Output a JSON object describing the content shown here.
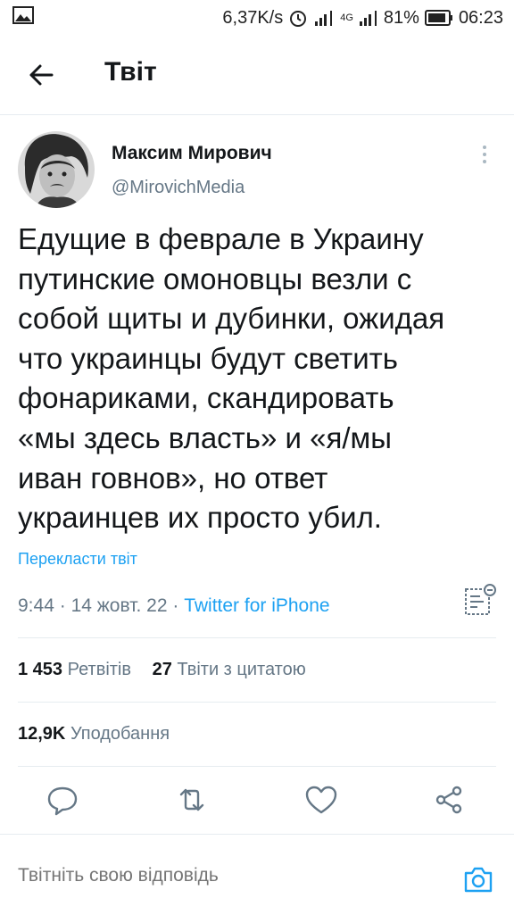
{
  "status_bar": {
    "speed": "6,37K/s",
    "battery_percent": "81%",
    "time": "06:23",
    "network_label": "4G"
  },
  "header": {
    "title": "Твіт"
  },
  "tweet": {
    "author_name": "Максим Мирович",
    "author_handle": "@MirovichMedia",
    "text_lines": [
      "Едущие в феврале в Украину",
      "путинские омоновцы везли с",
      "собой щиты и дубинки, ожидая",
      "что украинцы будут светить",
      "фонариками, скандировать",
      "«мы здесь власть» и «я/мы",
      "иван говнов», но ответ",
      "украинцев их просто убил."
    ],
    "translate_label": "Перекласти твіт",
    "time": "9:44",
    "date": "14 жовт. 22",
    "separator": "·",
    "source": "Twitter for iPhone"
  },
  "stats": {
    "retweets_count": "1 453",
    "retweets_label": "Ретвітів",
    "quotes_count": "27",
    "quotes_label": "Твіти з цитатою",
    "likes_count": "12,9K",
    "likes_label": "Уподобання"
  },
  "reply": {
    "placeholder": "Твітніть свою відповідь"
  },
  "colors": {
    "accent": "#1da1f2",
    "secondary_text": "#657786",
    "divider": "#e6ecf0"
  }
}
